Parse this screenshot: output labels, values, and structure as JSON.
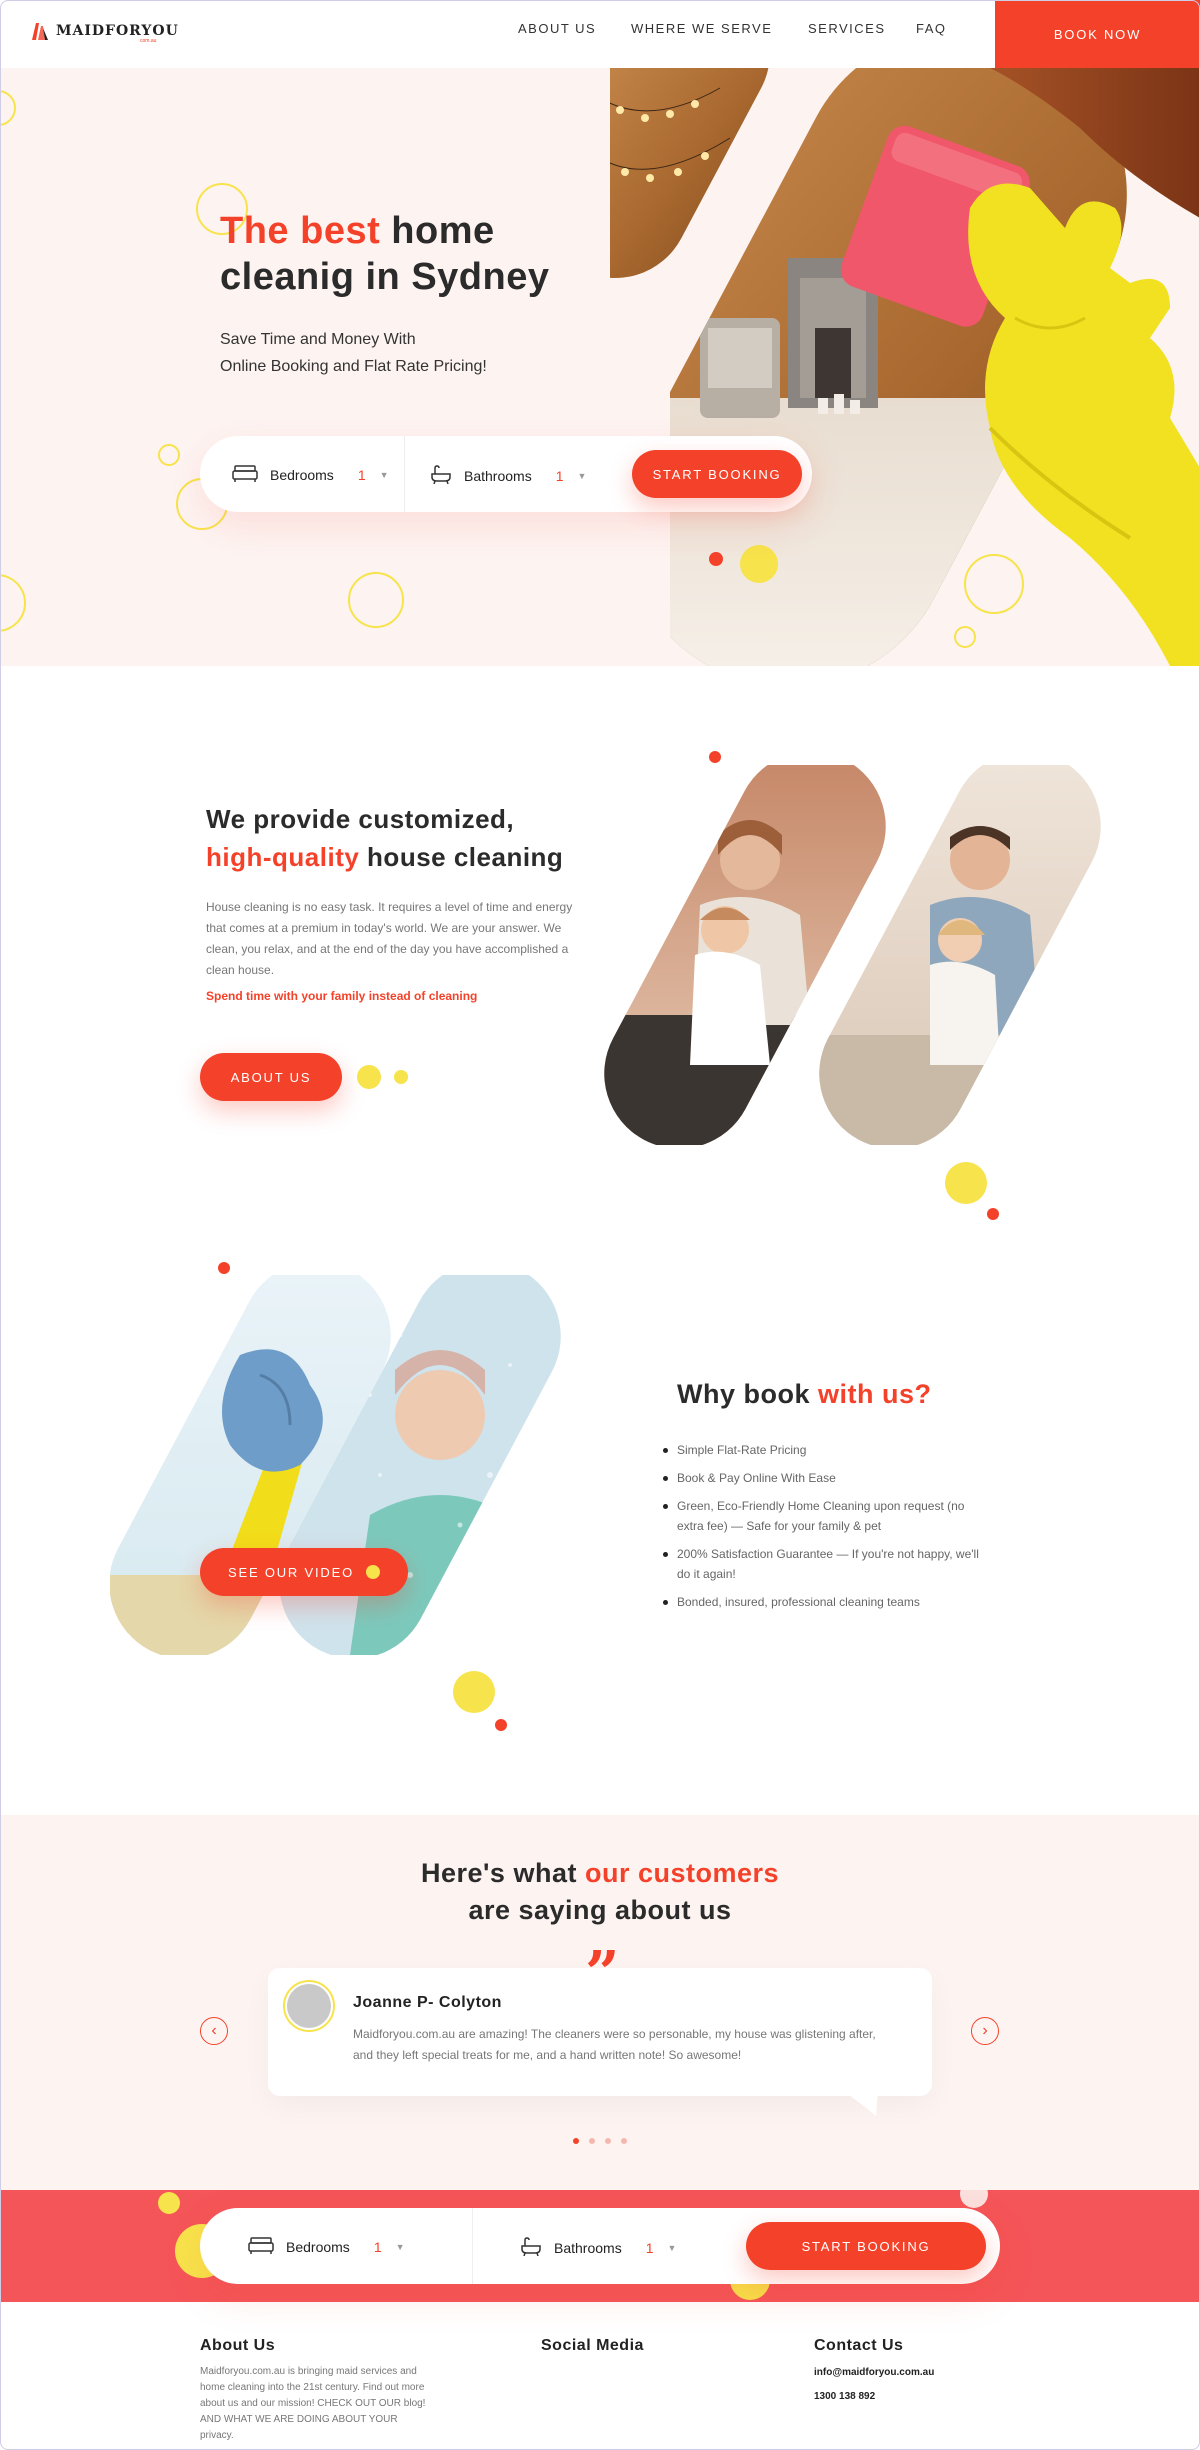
{
  "nav": {
    "logo_text": "MAIDFORYOU",
    "logo_sub": "com.au",
    "links": [
      "ABOUT US",
      "WHERE WE SERVE",
      "SERVICES",
      "FAQ"
    ],
    "book_now": "BOOK NOW"
  },
  "hero": {
    "title_accent": "The best",
    "title_rest_1": " home",
    "title_line_2": "cleanig in Sydney",
    "subtitle_1": "Save Time and Money With",
    "subtitle_2": "Online Booking and Flat Rate Pricing!",
    "booking": {
      "bedrooms_label": "Bedrooms",
      "bedrooms_value": "1",
      "bathrooms_label": "Bathrooms",
      "bathrooms_value": "1",
      "cta": "START BOOKING"
    }
  },
  "about": {
    "title_line_1": "We provide customized,",
    "title_accent": "high-quality",
    "title_rest": " house cleaning",
    "body": "House cleaning is no easy task. It requires a level of time and energy that comes at a premium in today's world. We are your answer. We clean, you relax, and at the end of the day you have accomplished a clean house.",
    "note": "Spend time with your family instead of cleaning",
    "cta": "ABOUT US"
  },
  "why": {
    "title_plain": "Why book ",
    "title_accent": "with us?",
    "video_cta": "SEE OUR VIDEO",
    "items": [
      "Simple Flat-Rate Pricing",
      "Book & Pay Online With Ease",
      "Green, Eco-Friendly Home Cleaning upon request (no extra fee) — Safe for your family & pet",
      "200% Satisfaction Guarantee — If you're not happy, we'll do it again!",
      "Bonded, insured, professional cleaning teams"
    ]
  },
  "testimonials": {
    "title_plain_1": "Here's what ",
    "title_accent": "our customers",
    "title_line_2": "are saying about us",
    "quote_glyph": "”",
    "name": "Joanne P- Colyton",
    "text": "Maidforyou.com.au are amazing! The cleaners were so personable, my house was glistening after, and they left special treats for me, and a hand written note! So awesome!",
    "prev": "‹",
    "next": "›",
    "pages": 4,
    "active_page": 1
  },
  "band_booking": {
    "bedrooms_label": "Bedrooms",
    "bedrooms_value": "1",
    "bathrooms_label": "Bathrooms",
    "bathrooms_value": "1",
    "cta": "START BOOKING"
  },
  "footer": {
    "about_title": "About Us",
    "about_text": "Maidforyou.com.au is bringing maid services and home cleaning into the 21st century. Find out more about us and our mission! CHECK OUT OUR blog! AND WHAT WE ARE DOING ABOUT YOUR privacy.",
    "social_title": "Social Media",
    "contact_title": "Contact Us",
    "email": "info@maidforyou.com.au",
    "phone": "1300 138 892"
  },
  "colors": {
    "accent": "#f4422a",
    "yellow": "#f7e34b",
    "hero_bg": "#fdf4f2",
    "band": "#f45558"
  },
  "icons": [
    "bed-icon",
    "bathtub-icon",
    "caret-down-icon",
    "play-dot-icon",
    "quote-icon",
    "arrow-left-icon",
    "arrow-right-icon"
  ]
}
